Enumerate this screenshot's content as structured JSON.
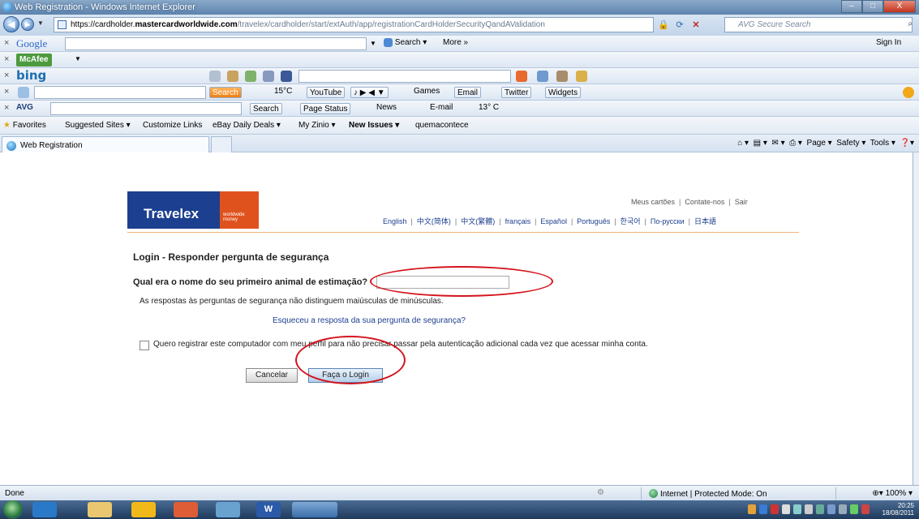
{
  "window": {
    "title": "Web Registration - Windows Internet Explorer",
    "buttons": [
      "–",
      "□",
      "X"
    ]
  },
  "address": {
    "url_prefix": "https://cardholder.",
    "url_domain": "mastercardworldwide.com",
    "url_path": "/travelex/cardholder/start/extAuth/app/registrationCardHolderSecurityQandAValidation",
    "search_placeholder": "AVG Secure Search"
  },
  "toolbars": {
    "google": {
      "logo": "Google",
      "search_label": "Search ▾",
      "more_label": "More »",
      "signin_label": "Sign In"
    },
    "mcafee": {
      "logo": "McAfee"
    },
    "bing": {
      "logo": "bing"
    },
    "weather_toolbar": {
      "search_label": "Search",
      "temp": "15°C",
      "youtube": "YouTube",
      "games": "Games",
      "email": "Email",
      "twitter": "Twitter",
      "widgets": "Widgets"
    },
    "avg": {
      "logo": "AVG",
      "search_label": "Search",
      "page_status": "Page Status",
      "news": "News",
      "email": "E-mail",
      "temp": "13° C"
    }
  },
  "favorites": {
    "favorites_label": "Favorites",
    "items": [
      "Suggested Sites ▾",
      "Customize Links",
      "eBay Daily Deals ▾",
      "My Zinio ▾",
      "New Issues ▾",
      "quemacontece"
    ]
  },
  "tab": {
    "label": "Web Registration"
  },
  "command_bar": {
    "page": "Page ▾",
    "safety": "Safety ▾",
    "tools": "Tools ▾"
  },
  "site": {
    "logo_main": "Travelex",
    "logo_sub": "worldwide money",
    "top_links": [
      "Meus cartões",
      "Contate-nos",
      "Sair"
    ],
    "languages": [
      "English",
      "中文(简体)",
      "中文(繁體)",
      "français",
      "Español",
      "Português",
      "한국어",
      "По-русски",
      "日本語"
    ],
    "heading": "Login - Responder pergunta de segurança",
    "question_label": "Qual era o nome do seu primeiro animal de estimação?",
    "answer_value": "",
    "hint": "As respostas às perguntas de segurança não distinguem maiúsculas de minúsculas.",
    "forgot_link": "Esqueceu a resposta da sua pergunta de segurança?",
    "remember_label": "Quero registrar este computador com meu perfil para não precisar passar pela autenticação adicional cada vez que acessar minha conta.",
    "cancel_button": "Cancelar",
    "login_button": "Faça o Login"
  },
  "status": {
    "left": "Done",
    "zone": "Internet | Protected Mode: On",
    "zoom": "100%"
  },
  "taskbar": {
    "time": "20:25",
    "date": "18/08/2011"
  },
  "colors": {
    "travelex_blue": "#1c3f8f",
    "travelex_orange": "#e0521d",
    "annotation_red": "#d4131b"
  }
}
